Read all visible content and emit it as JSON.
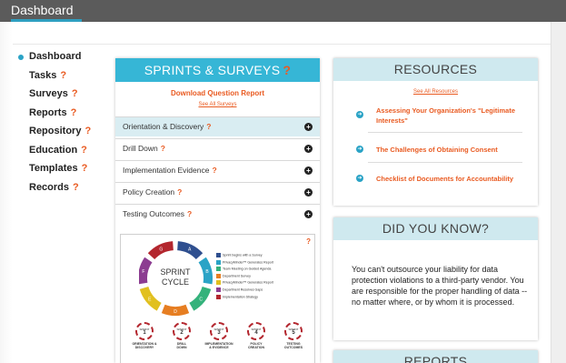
{
  "app": {
    "title": "Dashboard"
  },
  "sidebar": {
    "items": [
      {
        "label": "Dashboard",
        "help": ""
      },
      {
        "label": "Tasks",
        "help": "?"
      },
      {
        "label": "Surveys",
        "help": "?"
      },
      {
        "label": "Reports",
        "help": "?"
      },
      {
        "label": "Repository",
        "help": "?"
      },
      {
        "label": "Education",
        "help": "?"
      },
      {
        "label": "Templates",
        "help": "?"
      },
      {
        "label": "Records",
        "help": "?"
      }
    ]
  },
  "sprints": {
    "title": "SPRINTS & SURVEYS",
    "help": "?",
    "download_link": "Download Question Report",
    "see_all_link": "See All Surveys",
    "sections": [
      {
        "label": "Orientation & Discovery",
        "help": "?"
      },
      {
        "label": "Drill Down",
        "help": "?"
      },
      {
        "label": "Implementation Evidence",
        "help": "?"
      },
      {
        "label": "Policy Creation",
        "help": "?"
      },
      {
        "label": "Testing Outcomes",
        "help": "?"
      }
    ],
    "graphic": {
      "help": "?",
      "center_line1": "SPRINT",
      "center_line2": "CYCLE",
      "cycle_letters": [
        "A",
        "B",
        "C",
        "D",
        "E",
        "F",
        "G"
      ],
      "legend": [
        {
          "key": "A",
          "text": "Sprint begins with a Survey",
          "color": "#2f4f8f"
        },
        {
          "key": "B",
          "text": "PrivacyMinder™ Generates Report",
          "color": "#2aa3c6"
        },
        {
          "key": "C",
          "text": "Team Meeting on Guided Agenda",
          "color": "#34b27b"
        },
        {
          "key": "D",
          "text": "Department Survey",
          "color": "#e67e22"
        },
        {
          "key": "E",
          "text": "PrivacyMinder™ Generates Report",
          "color": "#e1c020"
        },
        {
          "key": "F",
          "text": "Department Resolves Gaps",
          "color": "#8c3d91"
        },
        {
          "key": "G",
          "text": "Implementation Strategy",
          "color": "#b3262e"
        }
      ],
      "badges": [
        {
          "word": "SPRINT",
          "num": "1",
          "label1": "ORIENTATION &",
          "label2": "DISCOVERY"
        },
        {
          "word": "SPRINT",
          "num": "2",
          "label1": "DRILL",
          "label2": "DOWN"
        },
        {
          "word": "SPRINT",
          "num": "3",
          "label1": "IMPLEMENTATION",
          "label2": "& EVIDENCE"
        },
        {
          "word": "SPRINT",
          "num": "4",
          "label1": "POLICY",
          "label2": "CREATION"
        },
        {
          "word": "SPRINT",
          "num": "5",
          "label1": "TESTING",
          "label2": "OUTCOMES"
        }
      ]
    }
  },
  "resources": {
    "title": "RESOURCES",
    "see_all": "See All Resources",
    "items": [
      {
        "text": "Assessing Your Organization's \"Legitimate Interests\""
      },
      {
        "text": "The Challenges of Obtaining Consent"
      },
      {
        "text": "Checklist of Documents for Accountability"
      }
    ]
  },
  "did_you_know": {
    "title": "DID YOU KNOW?",
    "body": "You can't outsource your liability for data protection violations to a third-party vendor.  You are responsible for the proper handling of data -- no matter where, or by whom it is processed."
  },
  "reports_panel": {
    "title": "REPORTS"
  },
  "colors": {
    "accent": "#36b6d6",
    "link": "#e95b22",
    "topbar": "#5b5b5b",
    "panel_head": "#cfe9ef"
  }
}
